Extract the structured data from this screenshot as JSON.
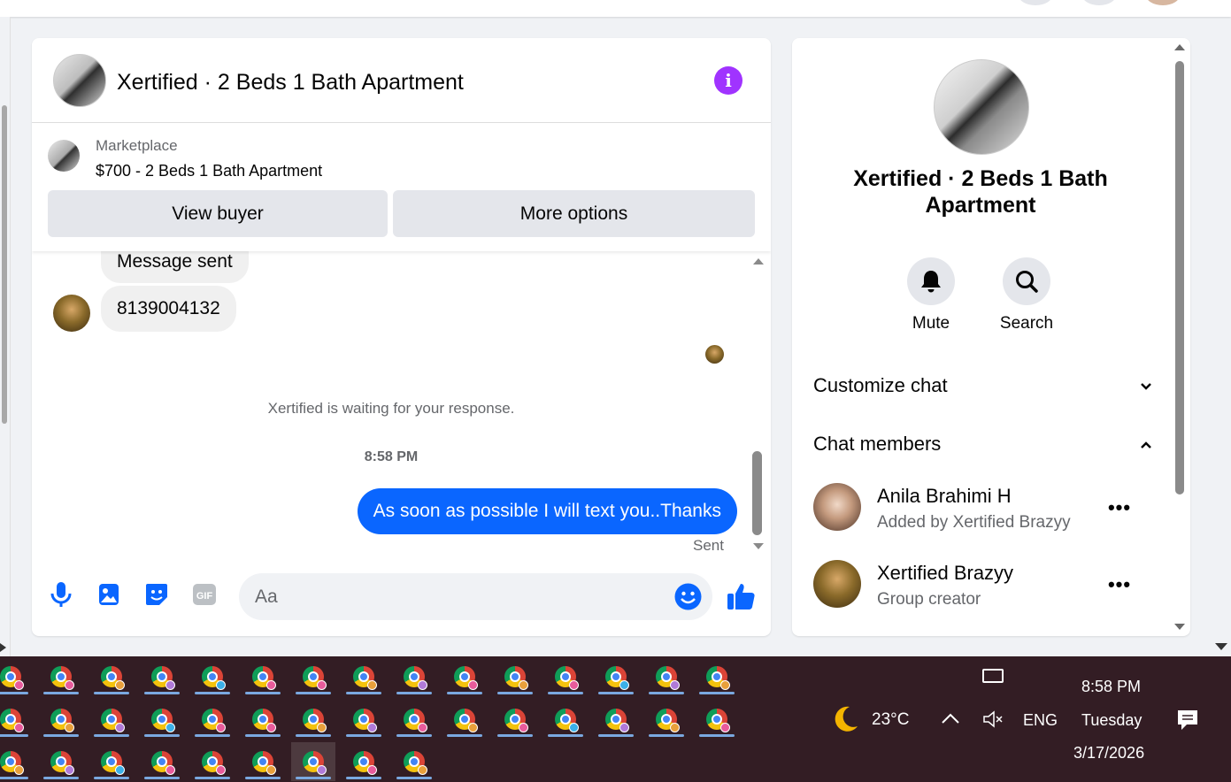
{
  "chat": {
    "title": "Xertified · 2 Beds 1 Bath Apartment",
    "listing": {
      "label": "Marketplace",
      "title": "$700 - 2 Beds 1 Bath Apartment",
      "view_buyer": "View buyer",
      "more_options": "More options"
    },
    "messages": {
      "partial": "Message sent",
      "phone": "8139004132",
      "waiting": "Xertified is waiting for your response.",
      "time": "8:58 PM",
      "outgoing": "As soon as possible I will text you..Thanks",
      "status": "Sent"
    },
    "composer": {
      "placeholder": "Aa"
    }
  },
  "details": {
    "title": "Xertified · 2 Beds 1 Bath Apartment",
    "mute": "Mute",
    "search": "Search",
    "customize": "Customize chat",
    "members_header": "Chat members",
    "members": [
      {
        "name": "Anila Brahimi H",
        "sub": "Added by Xertified Brazyy"
      },
      {
        "name": "Xertified Brazyy",
        "sub": "Group creator"
      }
    ]
  },
  "taskbar": {
    "weather_temp": "23°C",
    "lang": "ENG",
    "time": "8:58 PM",
    "day": "Tuesday",
    "date": "3/17/2026"
  },
  "colors": {
    "accent_blue": "#0a66ff",
    "info_purple": "#a033ff",
    "taskbar": "#331d24"
  }
}
